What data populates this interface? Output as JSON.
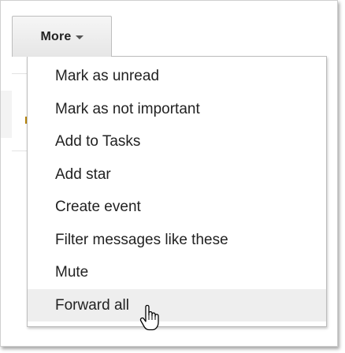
{
  "toolbar": {
    "more_button": {
      "label": "More",
      "icon": "chevron-down-icon"
    }
  },
  "menu": {
    "items": [
      {
        "label": "Mark as unread"
      },
      {
        "label": "Mark as not important"
      },
      {
        "label": "Add to Tasks"
      },
      {
        "label": "Add star"
      },
      {
        "label": "Create event"
      },
      {
        "label": "Filter messages like these"
      },
      {
        "label": "Mute"
      },
      {
        "label": "Forward all",
        "highlighted": true
      }
    ]
  },
  "cursor": {
    "icon": "hand-cursor-icon"
  },
  "colors": {
    "menu_text": "#222222",
    "highlight_bg": "#eeeeee",
    "border": "#bdbdbd"
  }
}
